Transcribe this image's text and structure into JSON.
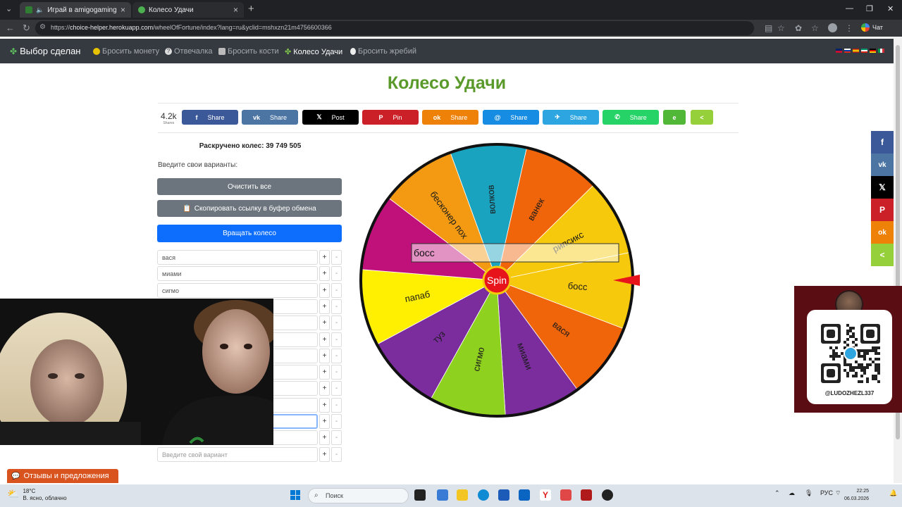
{
  "browser": {
    "tabs": [
      {
        "label": "Играй в amigogaming | joke"
      },
      {
        "label": "Колесо Удачи"
      }
    ],
    "url_prefix": "https://",
    "url_host": "choice-helper.herokuapp.com",
    "url_path": "/wheelOfFortune/index?lang=ru&yclid=mshxzn21m4756600366",
    "chat_label": "Чат"
  },
  "site": {
    "brand": "Выбор сделан",
    "nav": [
      {
        "label": "Бросить монету"
      },
      {
        "label": "Отвечалка"
      },
      {
        "label": "Бросить кости"
      },
      {
        "label": "Колесо Удачи"
      },
      {
        "label": "Бросить жребий"
      }
    ]
  },
  "page": {
    "title": "Колесо Удачи",
    "share_count": "4.2k",
    "shares_word": "Shares",
    "share_buttons": [
      {
        "icon": "f",
        "label": "Share",
        "color": "#3b5998"
      },
      {
        "icon": "vk",
        "label": "Share",
        "color": "#4c75a3"
      },
      {
        "icon": "𝕏",
        "label": "Post",
        "color": "#000000"
      },
      {
        "icon": "P",
        "label": "Pin",
        "color": "#cb2027"
      },
      {
        "icon": "ok",
        "label": "Share",
        "color": "#ee8208"
      },
      {
        "icon": "@",
        "label": "Share",
        "color": "#168de2"
      },
      {
        "icon": "✈",
        "label": "Share",
        "color": "#2ca5e0"
      },
      {
        "icon": "✆",
        "label": "Share",
        "color": "#25d366"
      },
      {
        "icon": "e",
        "label": "",
        "color": "#51b737"
      },
      {
        "icon": "<",
        "label": "",
        "color": "#95d03a"
      }
    ],
    "counter_text": "Раскручено колес: 39 749 505",
    "prompt": "Введите свои варианты:",
    "clear_all": "Очистить все",
    "copy_link": "Скопировать ссылку в буфер обмена",
    "spin_wheel": "Вращать колесо",
    "plus": "+",
    "minus": "-",
    "options": [
      {
        "value": "вася"
      },
      {
        "value": "миами"
      },
      {
        "value": "сигмо"
      },
      {
        "value": ""
      },
      {
        "value": ""
      },
      {
        "value": ""
      },
      {
        "value": ""
      },
      {
        "value": ""
      },
      {
        "value": ""
      },
      {
        "value": ""
      },
      {
        "value": ""
      }
    ],
    "placeholder": "Введите свой вариант",
    "feedback": "Отзывы и предложения"
  },
  "wheel": {
    "spin_label": "Spin",
    "editing_value": "босс",
    "segments": [
      {
        "label": "волков",
        "color": "#1aa3bf"
      },
      {
        "label": "ванек",
        "color": "#f0640a"
      },
      {
        "label": "рипсикс",
        "color": "#f7c90c"
      },
      {
        "label": "босс",
        "color": "#f7c90c"
      },
      {
        "label": "вася",
        "color": "#f0640a"
      },
      {
        "label": "миами",
        "color": "#7b2d9e"
      },
      {
        "label": "сигмо",
        "color": "#8fd11f"
      },
      {
        "label": "туз",
        "color": "#7b2d9e"
      },
      {
        "label": "папаб",
        "color": "#ffef00"
      },
      {
        "label": "",
        "color": "#c0117a"
      },
      {
        "label": "бесконер пох",
        "color": "#f39a12"
      }
    ]
  },
  "qr": {
    "handle": "@LUDOZHEZL337"
  },
  "taskbar": {
    "temp": "18°C",
    "weather": "В. ясно, облачно",
    "search": "Поиск",
    "lang": "РУС",
    "time": "22:25",
    "date": "06.03.2026"
  }
}
